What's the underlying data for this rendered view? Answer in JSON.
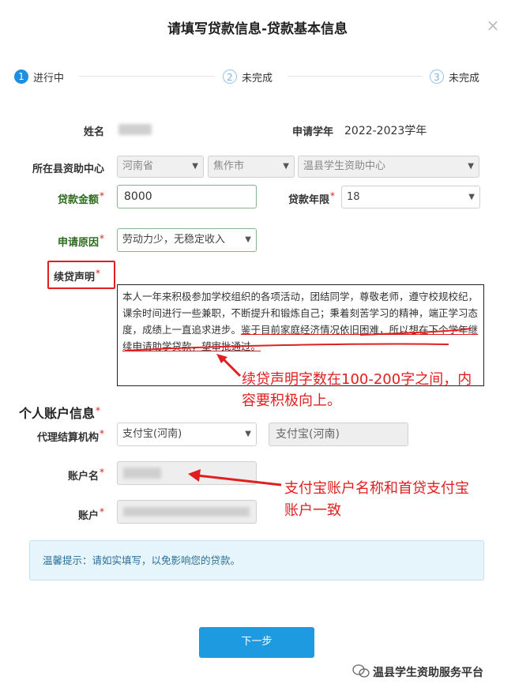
{
  "dialog": {
    "title": "请填写贷款信息-贷款基本信息",
    "close_glyph": "×"
  },
  "steps": [
    {
      "number": "1",
      "label": "进行中"
    },
    {
      "number": "2",
      "label": "未完成"
    },
    {
      "number": "3",
      "label": "未完成"
    }
  ],
  "form": {
    "name_label": "姓名",
    "year_label": "申请学年",
    "year_value": "2022-2023学年",
    "center_label": "所在县资助中心",
    "province": "河南省",
    "city": "焦作市",
    "center": "温县学生资助中心",
    "amount_label": "贷款金额",
    "amount_value": "8000",
    "term_label": "贷款年限",
    "term_value": "18",
    "reason_label": "申请原因",
    "reason_value": "劳动力少，无稳定收入",
    "statement_label": "续贷声明",
    "statement_text_1": "本人一年来积极参加学校组织的各项活动，团结同学，尊敬老师，遵守校规校纪，课余时间进行一些兼职，不断提升和锻炼自己；秉着刻苦学习的精神，端正学习态度，成绩上一直追求进步。",
    "statement_text_2": "鉴于目前家庭经济情况依旧困难，所以想在下个学年继续申请助学贷款，望审批通过。",
    "required_mark": "*"
  },
  "account": {
    "section_title": "个人账户信息",
    "agency_label": "代理结算机构",
    "agency_value": "支付宝(河南)",
    "agency_display": "支付宝(河南)",
    "account_name_label": "账户名",
    "account_label": "账户"
  },
  "annotations": {
    "statement_note_line1": "续贷声明字数在100-200字之间，内",
    "statement_note_line2": "容要积极向上。",
    "account_note_line1": "支付宝账户名称和首贷支付宝",
    "account_note_line2": "账户一致"
  },
  "notice": {
    "text": "温馨提示：请如实填写，以免影响您的贷款。"
  },
  "next_button": {
    "label": "下一步"
  },
  "watermark": {
    "text": "温县学生资助服务平台"
  },
  "colors": {
    "accent": "#1e9be0",
    "annotation": "#e02020",
    "label_green": "#2e6b1f"
  }
}
